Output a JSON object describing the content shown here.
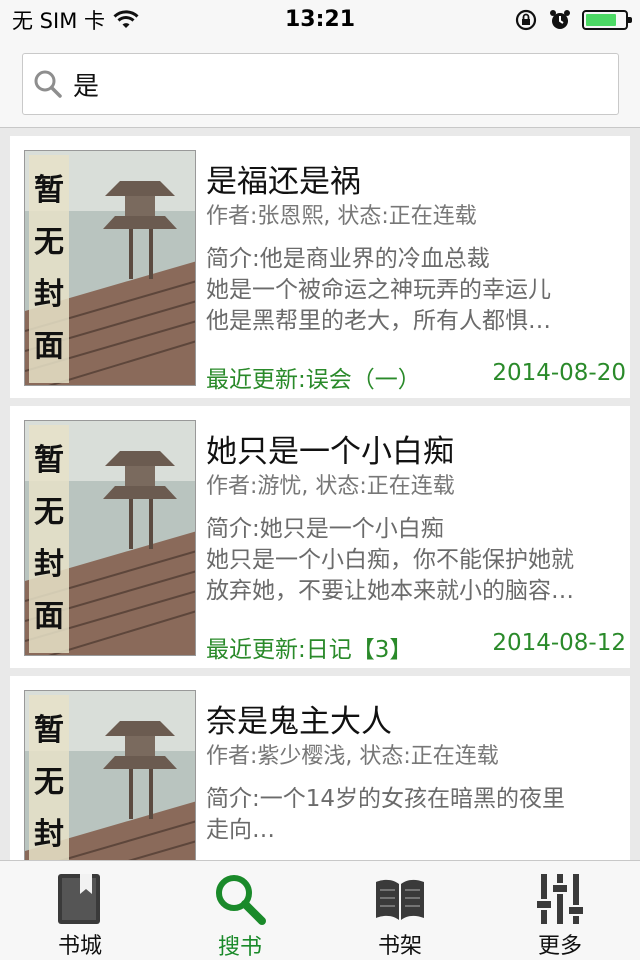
{
  "status_bar": {
    "carrier": "无 SIM 卡",
    "time": "13:21",
    "battery_level": 0.8
  },
  "search": {
    "query": "是",
    "placeholder": ""
  },
  "books": [
    {
      "title": "是福还是祸",
      "cover_text": "暂无封面",
      "meta": "作者:张恩熙, 状态:正在连载",
      "intro_lines": [
        "简介:他是商业界的冷血总裁",
        "她是一个被命运之神玩弄的幸运儿",
        "他是黑帮里的老大，所有人都惧…"
      ],
      "latest": "最近更新:误会（一）",
      "date": "2014-08-20"
    },
    {
      "title": "她只是一个小白痴",
      "cover_text": "暂无封面",
      "meta": "作者:游忧, 状态:正在连载",
      "intro_lines": [
        "简介:她只是一个小白痴",
        "她只是一个小白痴，你不能保护她就",
        "放弃她，不要让她本来就小的脑容…"
      ],
      "latest": "最近更新:日记【3】",
      "date": "2014-08-12"
    },
    {
      "title": "奈是鬼主大人",
      "cover_text": "暂无封面",
      "meta": "作者:紫少樱浅, 状态:正在连载",
      "intro_lines": [
        "简介:一个14岁的女孩在暗黑的夜里",
        "走向…"
      ],
      "latest": "",
      "date": ""
    }
  ],
  "tabs": [
    {
      "label": "书城",
      "icon": "bookmark-book-icon",
      "active": false
    },
    {
      "label": "搜书",
      "icon": "search-icon",
      "active": true
    },
    {
      "label": "书架",
      "icon": "open-book-icon",
      "active": false
    },
    {
      "label": "更多",
      "icon": "sliders-icon",
      "active": false
    }
  ],
  "colors": {
    "accent_green": "#1a8a2a",
    "update_green": "#2a8a2a",
    "battery_green": "#4cd964"
  }
}
